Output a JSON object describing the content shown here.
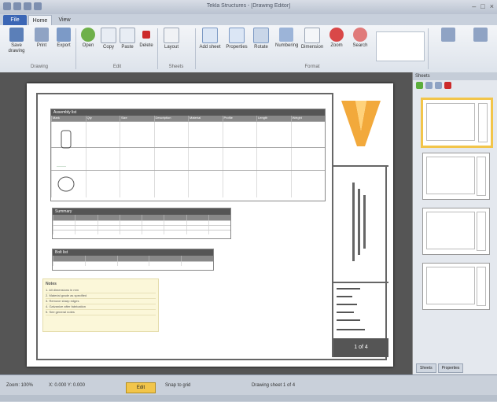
{
  "window": {
    "title": "Tekla Structures - [Drawing Editor]"
  },
  "tabs": [
    {
      "label": "File"
    },
    {
      "label": "Home"
    },
    {
      "label": "View"
    }
  ],
  "ribbon": {
    "buttons": [
      {
        "label": "Save drawing",
        "icon": "save-icon"
      },
      {
        "label": "Print",
        "icon": "print-icon"
      },
      {
        "label": "Export",
        "icon": "export-icon"
      },
      {
        "label": "Open",
        "icon": "open-icon"
      },
      {
        "label": "Copy",
        "icon": "copy-icon"
      },
      {
        "label": "Paste",
        "icon": "paste-icon"
      },
      {
        "label": "Delete",
        "icon": "delete-icon"
      },
      {
        "label": "Layout",
        "icon": "layout-icon"
      },
      {
        "label": "Add sheet",
        "icon": "add-sheet-icon"
      },
      {
        "label": "Properties",
        "icon": "properties-icon"
      },
      {
        "label": "Rotate",
        "icon": "rotate-icon"
      },
      {
        "label": "Numbering",
        "icon": "numbering-icon"
      },
      {
        "label": "Dimension",
        "icon": "dimension-icon"
      },
      {
        "label": "Zoom",
        "icon": "zoom-icon"
      },
      {
        "label": "Search",
        "icon": "search-icon"
      }
    ],
    "groups": [
      "Drawing",
      "Edit",
      "Sheets",
      "Format"
    ]
  },
  "drawing": {
    "table_title": "Assembly list",
    "columns": [
      "Mark",
      "Qty",
      "Size",
      "Description",
      "Material",
      "Profile",
      "Length",
      "Weight"
    ],
    "summary_title": "Summary",
    "bolts_title": "Bolt list",
    "notes_title": "Notes",
    "notes_lines": [
      "1. All dimensions in mm",
      "2. Material grade as specified",
      "3. Remove sharp edges",
      "4. Galvanize after fabrication",
      "5. See general notes"
    ],
    "sheet_label": "1 of 4"
  },
  "panel": {
    "title": "Sheets",
    "tabs": [
      "Sheets",
      "Properties"
    ]
  },
  "status": {
    "zoom": "Zoom: 100%",
    "coords": "X: 0.000  Y: 0.000",
    "badge": "Edit",
    "mode": "Snap to grid",
    "info": "Drawing sheet 1 of 4"
  },
  "accent": "#f2c54a"
}
